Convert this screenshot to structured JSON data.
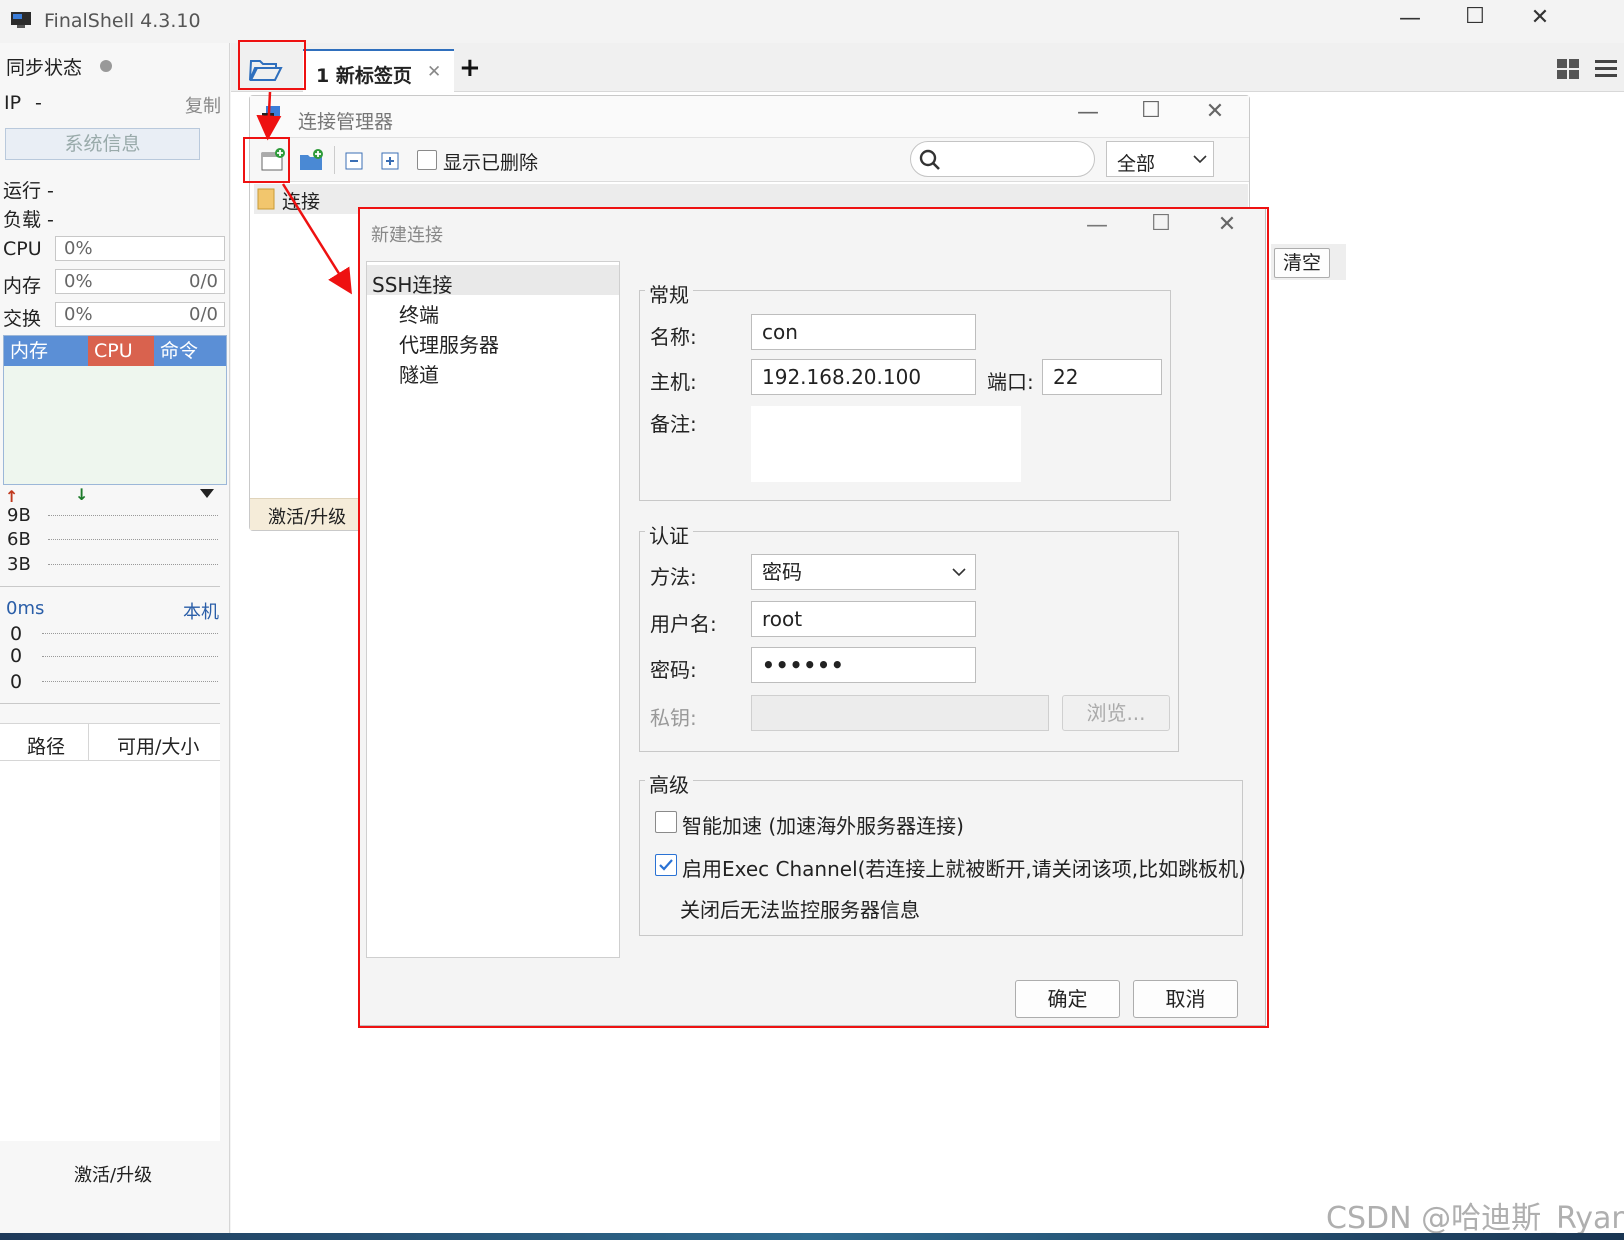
{
  "window": {
    "title": "FinalShell 4.3.10"
  },
  "left": {
    "sync_label": "同步状态",
    "ip_label": "IP",
    "ip_value": "-",
    "copy_label": "复制",
    "sysinfo_button": "系统信息",
    "run_label": "运行 -",
    "load_label": "负载 -",
    "cpu_label": "CPU",
    "cpu_value": "0%",
    "mem_label": "内存",
    "mem_value": "0%",
    "mem_ratio": "0/0",
    "swap_label": "交换",
    "swap_value": "0%",
    "swap_ratio": "0/0",
    "proc_tabs": [
      "内存",
      "CPU",
      "命令"
    ],
    "net_rows": [
      "9B",
      "6B",
      "3B"
    ],
    "latency": "0ms",
    "host": "本机",
    "ping_rows": [
      "0",
      "0",
      "0"
    ],
    "disk_headers": [
      "路径",
      "可用/大小"
    ],
    "activate": "激活/升级"
  },
  "tabs": {
    "active_tab": "1 新标签页"
  },
  "content": {
    "clear_button": "清空"
  },
  "conn_manager": {
    "title": "连接管理器",
    "show_deleted": "显示已删除",
    "filter_value": "全部",
    "tree_item": "连接",
    "activate": "激活/升级"
  },
  "dialog": {
    "title": "新建连接",
    "nav": {
      "root": "SSH连接",
      "children": [
        "终端",
        "代理服务器",
        "隧道"
      ]
    },
    "general": {
      "legend": "常规",
      "name_label": "名称:",
      "name_value": "con",
      "host_label": "主机:",
      "host_value": "192.168.20.100",
      "port_label": "端口:",
      "port_value": "22",
      "note_label": "备注:"
    },
    "auth": {
      "legend": "认证",
      "method_label": "方法:",
      "method_value": "密码",
      "user_label": "用户名:",
      "user_value": "root",
      "pass_label": "密码:",
      "pass_value": "••••••",
      "key_label": "私钥:",
      "browse_button": "浏览..."
    },
    "advanced": {
      "legend": "高级",
      "smart_accel": "智能加速 (加速海外服务器连接)",
      "exec_channel": "启用Exec Channel(若连接上就被断开,请关闭该项,比如跳板机)",
      "exec_note": "关闭后无法监控服务器信息"
    },
    "ok_button": "确定",
    "cancel_button": "取消"
  },
  "watermark": "CSDN @哈迪斯_Ryan",
  "colors": {
    "proc_tab_mem": "#5b8fd6",
    "proc_tab_cpu": "#d9624e",
    "proc_tab_cmd": "#5b8fd6",
    "annotation_red": "#e11111",
    "check_blue": "#2a72d4"
  }
}
